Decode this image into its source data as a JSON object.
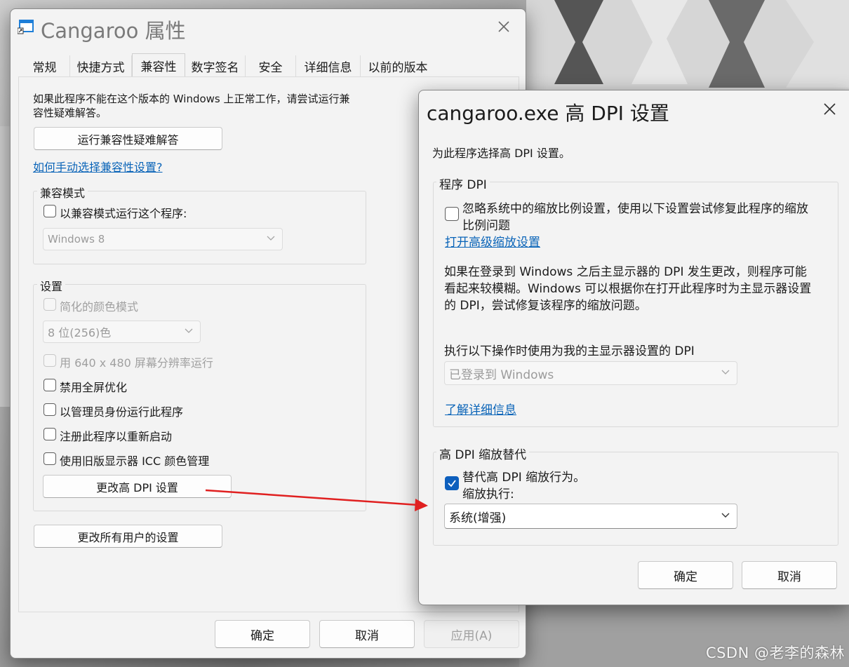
{
  "watermark": "CSDN @老李的森林",
  "props": {
    "title": "Cangaroo 属性",
    "tabs": [
      "常规",
      "快捷方式",
      "兼容性",
      "数字签名",
      "安全",
      "详细信息",
      "以前的版本"
    ],
    "intro": "如果此程序不能在这个版本的 Windows 上正常工作，请尝试运行兼容性疑难解答。",
    "intro_line1": "如果此程序不能在这个版本的 Windows 上正常工作，请尝试运行兼",
    "intro_line2": "容性疑难解答。",
    "troubleshoot_button": "运行兼容性疑难解答",
    "manual_link": "如何手动选择兼容性设置?",
    "compat_group": {
      "title": "兼容模式",
      "checkbox": "以兼容模式运行这个程序:",
      "os_select": "Windows 8"
    },
    "settings_group": {
      "title": "设置",
      "reduced_color": "简化的颜色模式",
      "color_select": "8 位(256)色",
      "res_640": "用 640 x 480 屏幕分辨率运行",
      "disable_fullscreen": "禁用全屏优化",
      "run_admin": "以管理员身份运行此程序",
      "register_restart": "注册此程序以重新启动",
      "legacy_icc": "使用旧版显示器 ICC 颜色管理",
      "change_dpi_button": "更改高 DPI 设置"
    },
    "all_users_button": "更改所有用户的设置",
    "ok": "确定",
    "cancel": "取消",
    "apply": "应用(A)"
  },
  "dpi": {
    "title": "cangaroo.exe 高 DPI 设置",
    "subtitle": "为此程序选择高 DPI 设置。",
    "program_dpi": {
      "title": "程序 DPI",
      "checkbox_line1": "忽略系统中的缩放比例设置，使用以下设置尝试修复此程序的缩放",
      "checkbox_line2": "比例问题",
      "advanced_link": "打开高级缩放设置",
      "desc_line1": "如果在登录到 Windows 之后主显示器的 DPI 发生更改，则程序可能",
      "desc_line2": "看起来较模糊。Windows 可以根据你在打开此程序时为主显示器设置",
      "desc_line3": "的 DPI，尝试修复该程序的缩放问题。",
      "use_dpi_label": "执行以下操作时使用为我的主显示器设置的 DPI",
      "use_dpi_select": "已登录到 Windows",
      "learn_more_link": "了解详细信息"
    },
    "override": {
      "title": "高 DPI 缩放替代",
      "checkbox": "替代高 DPI 缩放行为。",
      "scaling_label": "缩放执行:",
      "scaling_select": "系统(增强)"
    },
    "ok": "确定",
    "cancel": "取消"
  },
  "colors": {
    "accent": "#0d5fbd",
    "arrow": "#e02020",
    "link": "#0a64b8"
  }
}
